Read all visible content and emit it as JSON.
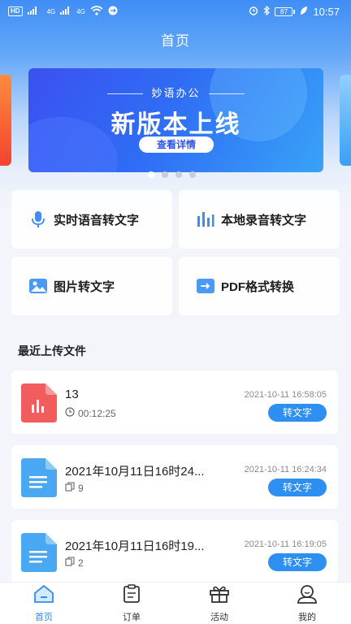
{
  "status_bar": {
    "carrier_badge": "HD",
    "network_1": "4G",
    "network_2": "4G",
    "battery": "87",
    "time": "10:57"
  },
  "header": {
    "title": "首页"
  },
  "banner": {
    "subtitle": "妙语办公",
    "headline": "新版本上线",
    "button_label": "查看详情",
    "slide_count": 4,
    "active_slide": 1
  },
  "features": [
    {
      "label": "实时语音转文字",
      "icon": "microphone-icon"
    },
    {
      "label": "本地录音转文字",
      "icon": "audio-bars-icon"
    },
    {
      "label": "图片转文字",
      "icon": "image-icon"
    },
    {
      "label": "PDF格式转换",
      "icon": "pdf-convert-icon"
    }
  ],
  "recent": {
    "title": "最近上传文件",
    "files": [
      {
        "name": "13",
        "meta": "00:12:25",
        "meta_icon": "clock-icon",
        "date": "2021-10-11 16:58:05",
        "action": "转文字",
        "file_icon": "audio-file-icon",
        "color": "#f25c5c"
      },
      {
        "name": "2021年10月11日16时24...",
        "meta": "9",
        "meta_icon": "pages-icon",
        "date": "2021-10-11 16:24:34",
        "action": "转文字",
        "file_icon": "doc-file-icon",
        "color": "#4aa8f2"
      },
      {
        "name": "2021年10月11日16时19...",
        "meta": "2",
        "meta_icon": "pages-icon",
        "date": "2021-10-11 16:19:05",
        "action": "转文字",
        "file_icon": "doc-file-icon",
        "color": "#4aa8f2"
      }
    ]
  },
  "tabs": [
    {
      "label": "首页",
      "icon": "home-icon",
      "active": true
    },
    {
      "label": "订单",
      "icon": "order-icon",
      "active": false
    },
    {
      "label": "活动",
      "icon": "gift-icon",
      "active": false
    },
    {
      "label": "我的",
      "icon": "profile-icon",
      "active": false
    }
  ],
  "colors": {
    "accent": "#2e8ff2",
    "banner": "#3b51f0",
    "audio_file": "#f25c5c",
    "doc_file": "#4aa8f2"
  }
}
